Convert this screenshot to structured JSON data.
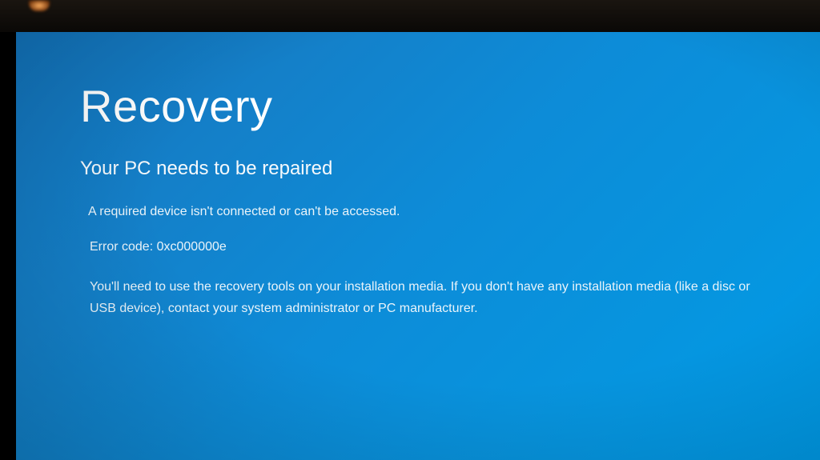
{
  "recovery": {
    "title": "Recovery",
    "subtitle": "Your PC needs to be repaired",
    "message": "A required device isn't connected or can't be accessed.",
    "error_label": "Error code:",
    "error_code": "0xc000000e",
    "instructions": "You'll need to use the recovery tools on your installation media. If you don't have any installation media (like a disc or USB device), contact your system administrator or PC manufacturer."
  }
}
